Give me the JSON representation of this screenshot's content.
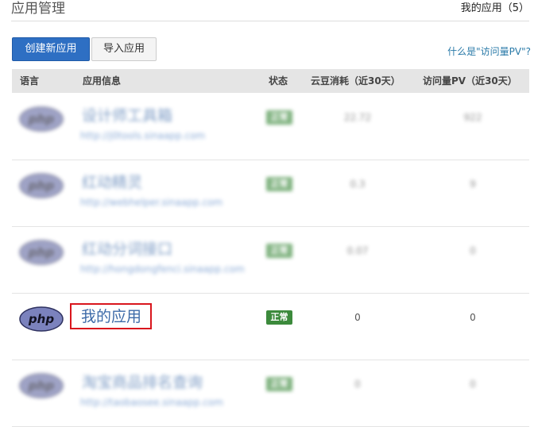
{
  "header": {
    "title": "应用管理",
    "my_apps": "我的应用（5）"
  },
  "toolbar": {
    "create_label": "创建新应用",
    "import_label": "导入应用",
    "help_link": "什么是\"访问量PV\"?"
  },
  "table": {
    "columns": [
      "语言",
      "应用信息",
      "状态",
      "云豆消耗（近30天）",
      "访问量PV（近30天）"
    ],
    "rows": [
      {
        "name": "设计师工具箱",
        "url": "http://j0tools.sinaapp.com",
        "status": "正常",
        "beans": "22.72",
        "pv": "922",
        "blurred": true
      },
      {
        "name": "红动精灵",
        "url": "http://webhelper.sinaapp.com",
        "status": "正常",
        "beans": "0.3",
        "pv": "9",
        "blurred": true
      },
      {
        "name": "红动分词接口",
        "url": "http://hongdongfenci.sinaapp.com",
        "status": "正常",
        "beans": "0.07",
        "pv": "0",
        "blurred": true
      },
      {
        "name": "我的应用",
        "url": "",
        "status": "正常",
        "beans": "0",
        "pv": "0",
        "blurred": false
      },
      {
        "name": "淘宝商品排名查询",
        "url": "http://taobaosee.sinaapp.com",
        "status": "正常",
        "beans": "0",
        "pv": "0",
        "blurred": true
      }
    ]
  },
  "logo_text": "php",
  "colors": {
    "primary": "#2e6fc3",
    "status_ok": "#3c8a3c",
    "highlight": "#d9161d",
    "link": "#2a7aa8"
  },
  "icons": {
    "language": "php-logo-icon"
  }
}
